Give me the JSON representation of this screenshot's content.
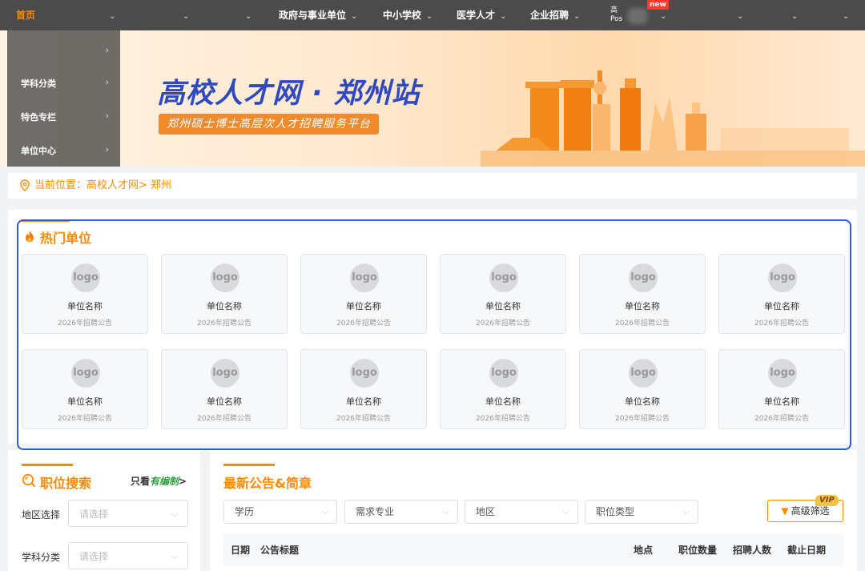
{
  "nav": {
    "home": "首页",
    "items": [
      "政府与事业单位",
      "中小学校",
      "医学人才",
      "企业招聘"
    ],
    "truncated_label": "高",
    "truncated_sub": "Pos",
    "new_badge": "new"
  },
  "side_menu": [
    "学科分类",
    "特色专栏",
    "单位中心"
  ],
  "banner": {
    "title": "高校人才网 · 郑州站",
    "subtitle": "郑州硕士博士高层次人才招聘服务平台"
  },
  "breadcrumb": "当前位置：高校人才网> 郑州",
  "hot_units": {
    "title": "热门单位",
    "cards": [
      {
        "logo": "logo",
        "name": "单位名称",
        "sub": "2026年招聘公告"
      },
      {
        "logo": "logo",
        "name": "单位名称",
        "sub": "2026年招聘公告"
      },
      {
        "logo": "logo",
        "name": "单位名称",
        "sub": "2026年招聘公告"
      },
      {
        "logo": "logo",
        "name": "单位名称",
        "sub": "2026年招聘公告"
      },
      {
        "logo": "logo",
        "name": "单位名称",
        "sub": "2026年招聘公告"
      },
      {
        "logo": "logo",
        "name": "单位名称",
        "sub": "2026年招聘公告"
      },
      {
        "logo": "logo",
        "name": "单位名称",
        "sub": "2026年招聘公告"
      },
      {
        "logo": "logo",
        "name": "单位名称",
        "sub": "2026年招聘公告"
      },
      {
        "logo": "logo",
        "name": "单位名称",
        "sub": "2026年招聘公告"
      },
      {
        "logo": "logo",
        "name": "单位名称",
        "sub": "2026年招聘公告"
      },
      {
        "logo": "logo",
        "name": "单位名称",
        "sub": "2026年招聘公告"
      },
      {
        "logo": "logo",
        "name": "单位名称",
        "sub": "2026年招聘公告"
      }
    ]
  },
  "job_search": {
    "title": "职位搜索",
    "filter_prefix": "只看",
    "filter_highlight": "有编制",
    "filter_suffix": ">",
    "fields": [
      {
        "label": "地区选择",
        "placeholder": "请选择"
      },
      {
        "label": "学科分类",
        "placeholder": "请选择"
      }
    ]
  },
  "announcements": {
    "title": "最新公告&简章",
    "filters": [
      "学历",
      "需求专业",
      "地区",
      "职位类型"
    ],
    "advanced_button": "高级筛选",
    "vip_badge": "VIP",
    "columns": [
      "日期",
      "公告标题",
      "地点",
      "职位数量",
      "招聘人数",
      "截止日期"
    ]
  },
  "colors": {
    "accent": "#ff8a00",
    "nav_bg": "#4b4b4b",
    "banner_title": "#2f49c0",
    "highlight_border": "#2c5bd8"
  }
}
